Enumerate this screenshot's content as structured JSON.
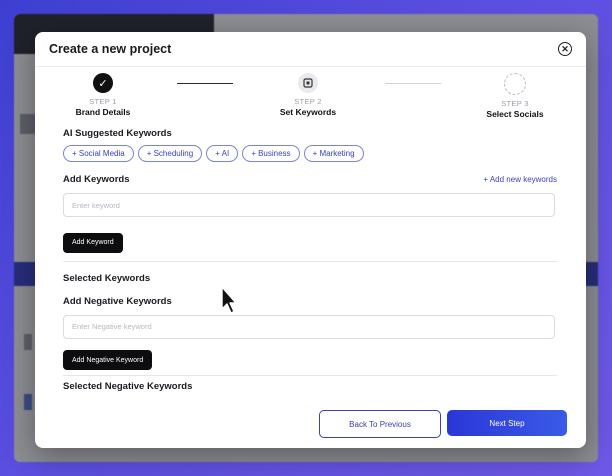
{
  "modal": {
    "title": "Create a new project",
    "close_icon": "close-circle-icon"
  },
  "stepper": {
    "steps": [
      {
        "number": "STEP 1",
        "label": "Brand Details",
        "state": "complete",
        "icon": "check-icon"
      },
      {
        "number": "STEP 2",
        "label": "Set Keywords",
        "state": "current",
        "icon": "square-dot-icon"
      },
      {
        "number": "STEP 3",
        "label": "Select Socials",
        "state": "pending",
        "icon": "dashed-circle-icon"
      }
    ]
  },
  "ai_keywords": {
    "title": "AI Suggested Keywords",
    "chips": [
      "+ Social Media",
      "+ Scheduling",
      "+ AI",
      "+ Business",
      "+ Marketing"
    ]
  },
  "add_keywords": {
    "title": "Add Keywords",
    "add_new_link": "+ Add new keywords",
    "placeholder": "Enter keyword",
    "button": "Add Keyword"
  },
  "selected_keywords": {
    "title": "Selected Keywords"
  },
  "negative_keywords": {
    "title": "Add Negative Keywords",
    "placeholder": "Enter Negative keyword",
    "button": "Add Negative Keyword"
  },
  "selected_negative": {
    "title": "Selected Negative Keywords"
  },
  "footer": {
    "back": "Back To Previous",
    "next": "Next Step"
  },
  "colors": {
    "accent": "#3a42c4",
    "primary_button": "#2b36d8",
    "dark_button": "#0d0d0f"
  }
}
